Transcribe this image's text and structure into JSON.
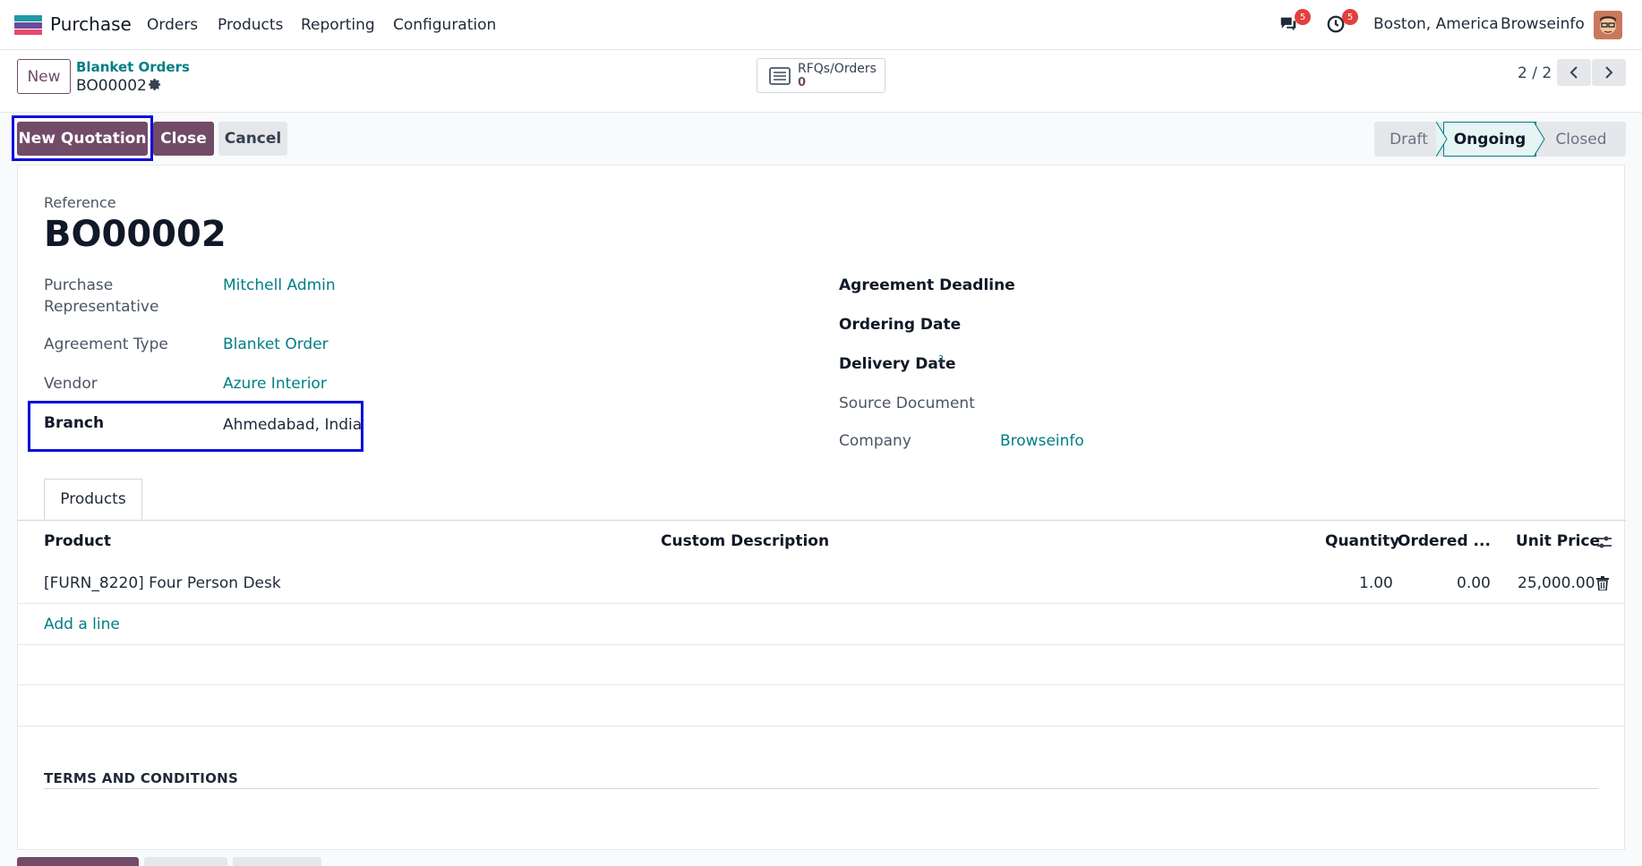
{
  "navbar": {
    "app_name": "Purchase",
    "menu": [
      "Orders",
      "Products",
      "Reporting",
      "Configuration"
    ],
    "messages_count": "5",
    "activities_count": "5",
    "location": "Boston, America",
    "company": "Browseinfo"
  },
  "control": {
    "new_label": "New",
    "breadcrumb": "Blanket Orders",
    "record": "BO00002",
    "smart_button_label": "RFQs/Orders",
    "smart_button_value": "0",
    "pager": "2 / 2"
  },
  "actions": {
    "new_quotation": "New Quotation",
    "close": "Close",
    "cancel": "Cancel"
  },
  "stages": [
    "Draft",
    "Ongoing",
    "Closed"
  ],
  "form": {
    "reference_label": "Reference",
    "reference": "BO00002",
    "rep_label_1": "Purchase",
    "rep_label_2": "Representative",
    "rep_value": "Mitchell Admin",
    "agreement_type_label": "Agreement Type",
    "agreement_type": "Blanket Order",
    "vendor_label": "Vendor",
    "vendor": "Azure Interior",
    "branch_label": "Branch",
    "branch": "Ahmedabad, India",
    "deadline_label": "Agreement Deadline",
    "ordering_date_label": "Ordering Date",
    "delivery_date_label": "Delivery Date",
    "delivery_help": "?",
    "source_doc_label": "Source Document",
    "company_label": "Company",
    "company": "Browseinfo"
  },
  "tabs": {
    "products": "Products"
  },
  "table": {
    "headers": {
      "product": "Product",
      "description": "Custom Description",
      "quantity": "Quantity",
      "ordered": "Ordered ...",
      "unit_price": "Unit Price"
    },
    "rows": [
      {
        "product": "[FURN_8220] Four Person Desk",
        "quantity": "1.00",
        "ordered": "0.00",
        "unit_price": "25,000.00"
      }
    ],
    "add_line": "Add a line"
  },
  "terms_title": "TERMS AND CONDITIONS",
  "colors": {
    "primary": "#714b67",
    "link": "#017e84",
    "highlight": "#0a0adb",
    "badge": "#e53e3e"
  }
}
